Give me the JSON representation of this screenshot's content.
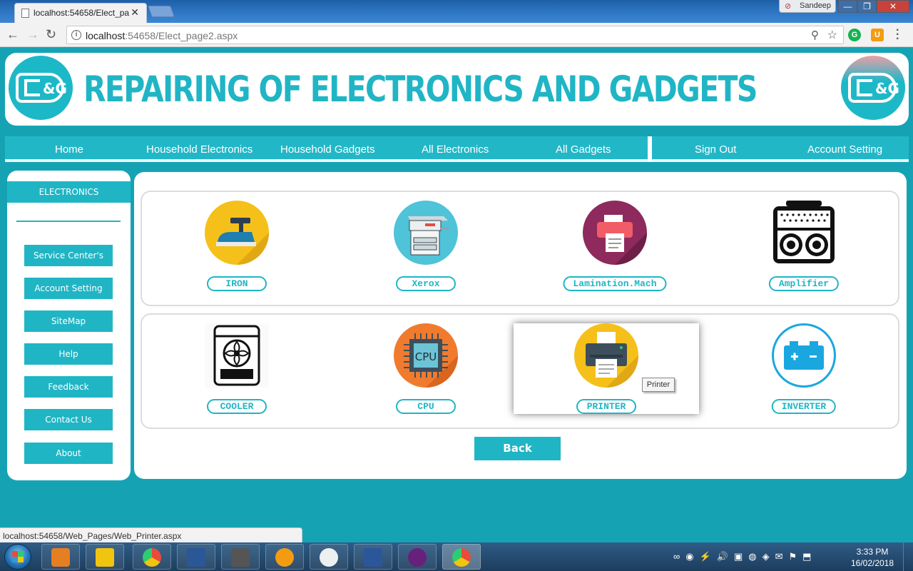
{
  "browser": {
    "tab_title": "localhost:54658/Elect_pa",
    "url_host": "localhost",
    "url_path": ":54658/Elect_page2.aspx",
    "user": "Sandeep",
    "status_url": "localhost:54658/Web_Pages/Web_Printer.aspx"
  },
  "header": {
    "title": "REPAIRING OF  ELECTRONICS AND GADGETS",
    "logo_text": "&G"
  },
  "nav": {
    "items": [
      "Home",
      "Household Electronics",
      "Household Gadgets",
      "All Electronics",
      "All Gadgets",
      "Sign Out",
      "Account Setting"
    ]
  },
  "sidebar": {
    "heading": "ELECTRONICS",
    "items": [
      "Service Center's",
      "Account Setting",
      "SiteMap",
      "Help",
      "Feedback",
      "Contact Us",
      "About"
    ]
  },
  "products": {
    "row1": [
      "IRON",
      "Xerox",
      "Lamination.Mach",
      "Amplifier"
    ],
    "row2": [
      "COOLER",
      "CPU",
      "PRINTER",
      "INVERTER"
    ],
    "tooltip": "Printer",
    "back_label": "Back"
  },
  "taskbar": {
    "time": "3:33 PM",
    "date": "16/02/2018"
  },
  "colors": {
    "accent": "#20b5c5",
    "page_bg": "#15a3b4"
  }
}
